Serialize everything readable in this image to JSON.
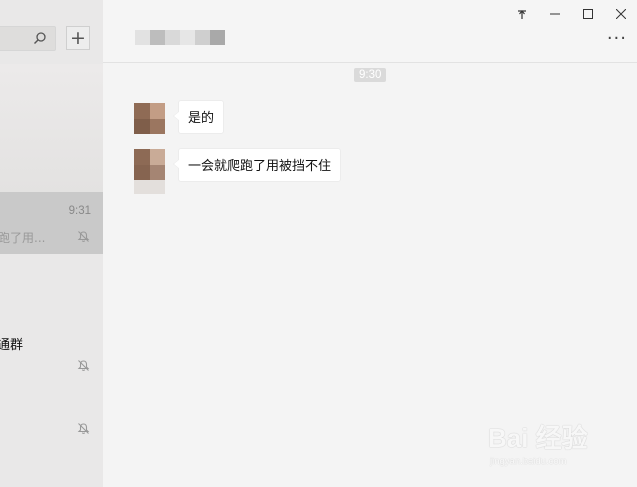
{
  "sidebar": {
    "add_label": "+",
    "chats": [
      {
        "time": "9:31",
        "preview": "跑了用..."
      },
      {
        "name": "通群"
      }
    ]
  },
  "header": {
    "window_controls": [
      "pin-icon",
      "minimize-icon",
      "maximize-icon",
      "close-icon"
    ],
    "more_label": "···"
  },
  "conversation": {
    "time_separator": "9:30",
    "messages": [
      {
        "text": "是的"
      },
      {
        "text": "一会就爬跑了用被挡不住"
      }
    ]
  },
  "watermark": {
    "text": "Bai 经验",
    "sub": "jingyan.baidu.com"
  },
  "colors": {
    "sidebar_bg": "#e9e8e8",
    "active_chat": "#c9c9c9",
    "main_bg": "#f4f4f4",
    "bubble_bg": "#ffffff"
  }
}
